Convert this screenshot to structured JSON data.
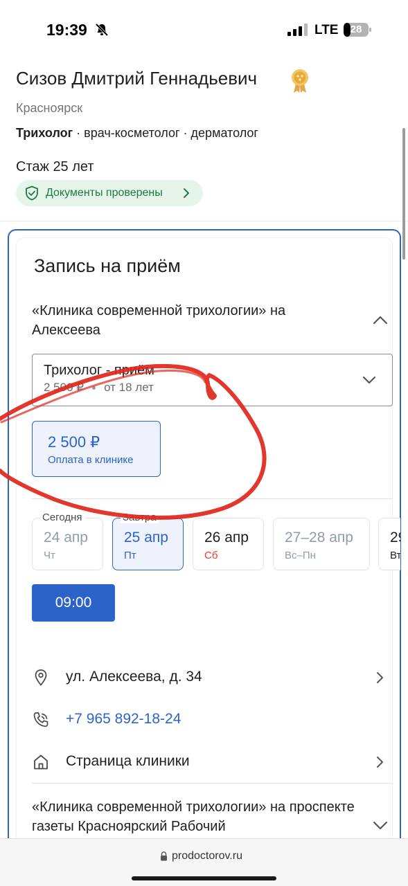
{
  "status_bar": {
    "time": "19:39",
    "network": "LTE",
    "battery": "28"
  },
  "doctor": {
    "name": "Сизов Дмитрий Геннадьевич",
    "city": "Красноярск",
    "main_specialty": "Трихолог",
    "other_specialties": " · врач-косметолог · дерматолог",
    "experience": "Стаж 25 лет",
    "documents_badge": "Документы проверены"
  },
  "booking": {
    "title": "Запись на приём",
    "clinic_name": "«Клиника современной трихологии» на Алексеева",
    "service": {
      "name": "Трихолог - приём",
      "price": "2 500 ₽",
      "age": "от 18 лет"
    },
    "price_option": {
      "amount": "2 500 ₽",
      "note": "Оплата в клинике"
    },
    "days": [
      {
        "tag": "Сегодня",
        "date": "24 апр",
        "weekday": "Чт"
      },
      {
        "tag": "Завтра",
        "date": "25 апр",
        "weekday": "Пт"
      },
      {
        "tag": "",
        "date": "26 апр",
        "weekday": "Сб"
      },
      {
        "tag": "",
        "date": "27–28 апр",
        "weekday": "Вс–Пн"
      },
      {
        "tag": "",
        "date": "29",
        "weekday": "Вт"
      }
    ],
    "time_slot": "09:00",
    "address": "ул. Алексеева, д. 34",
    "phone": "+7 965 892-18-24",
    "clinic_page": "Страница клиники",
    "next_clinic_name": "«Клиника современной трихологии» на проспекте газеты Красноярский Рабочий"
  },
  "browser": {
    "url": "prodoctorov.ru"
  },
  "colors": {
    "accent": "#2c63c9",
    "success": "#1e7a3e",
    "weekend": "#e53b2c",
    "annotation": "#e0261b"
  }
}
